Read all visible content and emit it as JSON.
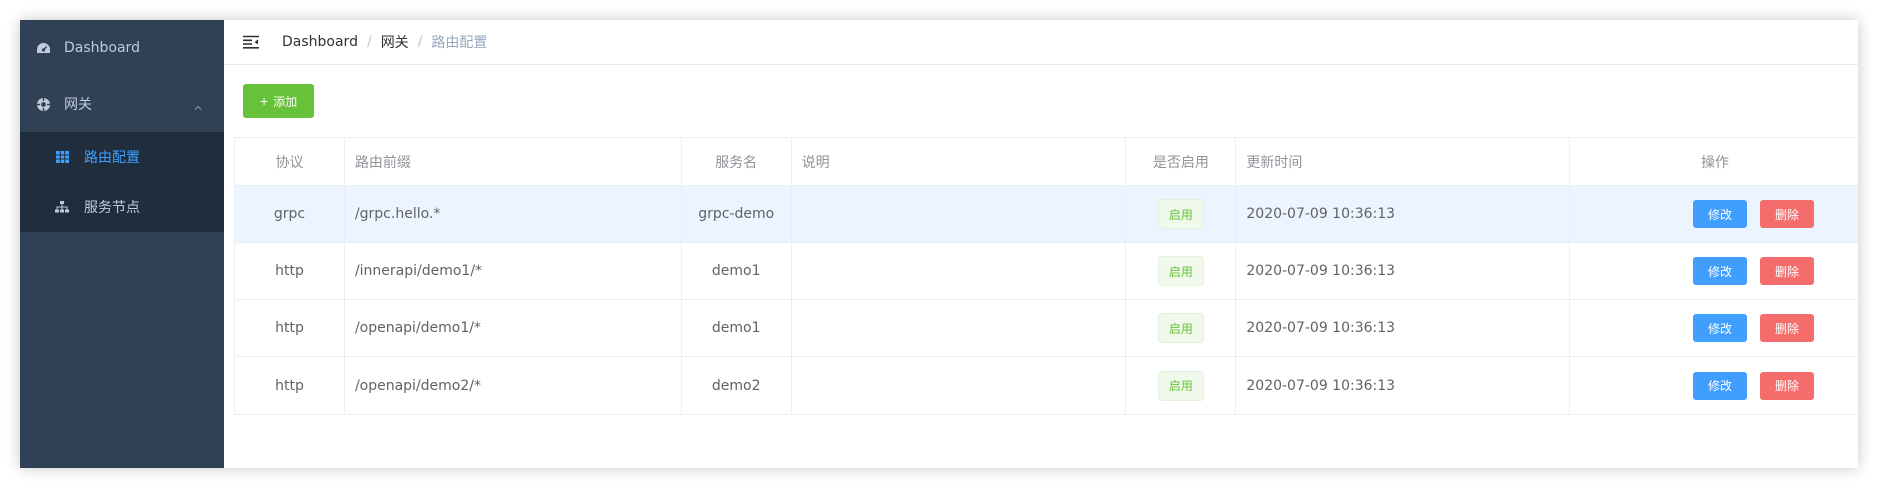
{
  "sidebar": {
    "items": [
      {
        "label": "Dashboard",
        "icon": "dashboard-icon"
      },
      {
        "label": "网关",
        "icon": "compass-icon",
        "expanded": true,
        "children": [
          {
            "label": "路由配置",
            "icon": "grid-icon",
            "active": true
          },
          {
            "label": "服务节点",
            "icon": "sitemap-icon",
            "active": false
          }
        ]
      }
    ]
  },
  "navbar": {
    "breadcrumb": [
      "Dashboard",
      "网关",
      "路由配置"
    ]
  },
  "toolbar": {
    "add_label": "添加"
  },
  "table": {
    "columns": [
      "协议",
      "路由前缀",
      "服务名",
      "说明",
      "是否启用",
      "更新时间",
      "操作"
    ],
    "rows": [
      {
        "protocol": "grpc",
        "prefix": "/grpc.hello.*",
        "service": "grpc-demo",
        "desc": "",
        "enabled": "启用",
        "updated": "2020-07-09 10:36:13",
        "edit": "修改",
        "delete": "删除"
      },
      {
        "protocol": "http",
        "prefix": "/innerapi/demo1/*",
        "service": "demo1",
        "desc": "",
        "enabled": "启用",
        "updated": "2020-07-09 10:36:13",
        "edit": "修改",
        "delete": "删除"
      },
      {
        "protocol": "http",
        "prefix": "/openapi/demo1/*",
        "service": "demo1",
        "desc": "",
        "enabled": "启用",
        "updated": "2020-07-09 10:36:13",
        "edit": "修改",
        "delete": "删除"
      },
      {
        "protocol": "http",
        "prefix": "/openapi/demo2/*",
        "service": "demo2",
        "desc": "",
        "enabled": "启用",
        "updated": "2020-07-09 10:36:13",
        "edit": "修改",
        "delete": "删除"
      }
    ]
  },
  "colors": {
    "sidebar_bg": "#304156",
    "submenu_bg": "#1f2d3d",
    "active": "#409eff",
    "success": "#67c23a",
    "danger": "#f56c6c"
  }
}
